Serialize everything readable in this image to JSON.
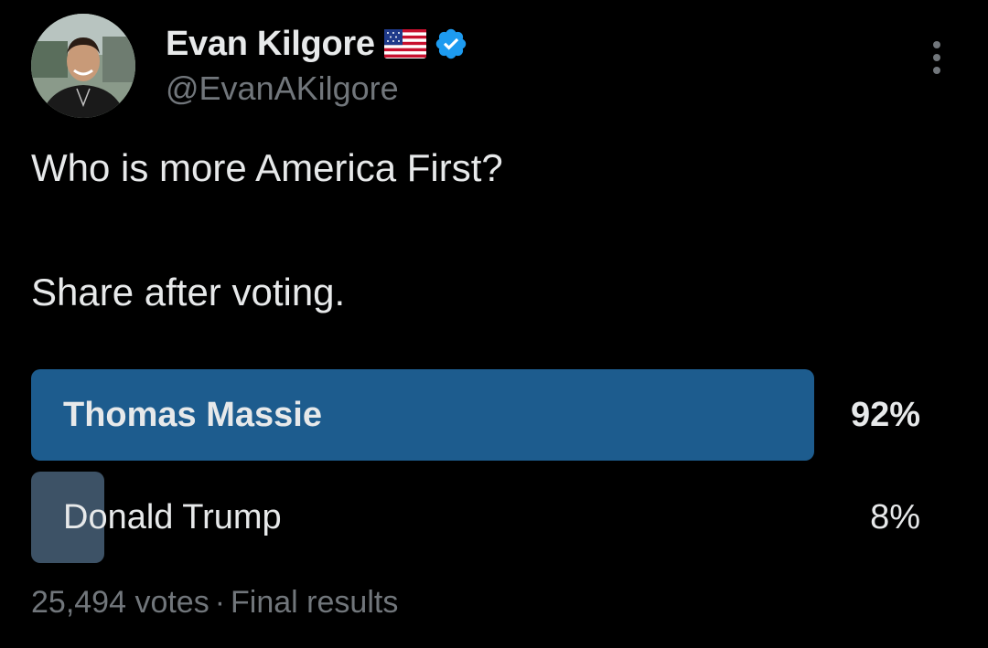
{
  "colors": {
    "background": "#000000",
    "primary_text": "#e7e9ea",
    "secondary_text": "#71767b",
    "winning_bar": "#1d5c8e",
    "losing_bar": "#3d5266",
    "verified_badge": "#1d9bf0"
  },
  "author": {
    "display_name": "Evan Kilgore",
    "flag_icon": "us-flag-icon",
    "verified_icon": "verified-badge-icon",
    "handle": "@EvanAKilgore",
    "avatar": "profile-photo"
  },
  "more_icon": "more-options-icon",
  "tweet": {
    "line1": "Who is more America First?",
    "line2": "Share after voting."
  },
  "poll": {
    "options": [
      {
        "label": "Thomas Massie",
        "percent_text": "92%",
        "percent": 92,
        "winner": true
      },
      {
        "label": "Donald Trump",
        "percent_text": "8%",
        "percent": 8,
        "winner": false
      }
    ],
    "votes": "25,494 votes",
    "separator": "·",
    "status": "Final results"
  }
}
